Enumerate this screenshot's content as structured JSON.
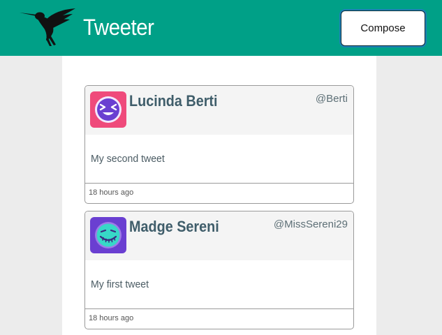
{
  "header": {
    "logo_icon": "hummingbird-icon",
    "title": "Tweeter",
    "compose_label": "Compose"
  },
  "colors": {
    "header_bg": "#00a087",
    "page_bg": "#ececec",
    "name_color": "#3f5d6a"
  },
  "tweets": [
    {
      "name": "Lucinda Berti",
      "handle": "@Berti",
      "text": "My second tweet",
      "timestamp": "18 hours ago",
      "avatar_icon": "grinning-squint-face-icon",
      "avatar_bg": "#ef4a7b",
      "avatar_face": "#6a3fd1"
    },
    {
      "name": "Madge Sereni",
      "handle": "@MissSereni29",
      "text": "My first tweet",
      "timestamp": "18 hours ago",
      "avatar_icon": "stitched-smile-face-icon",
      "avatar_bg": "#6a3fd1",
      "avatar_face": "#37d8c7"
    }
  ]
}
